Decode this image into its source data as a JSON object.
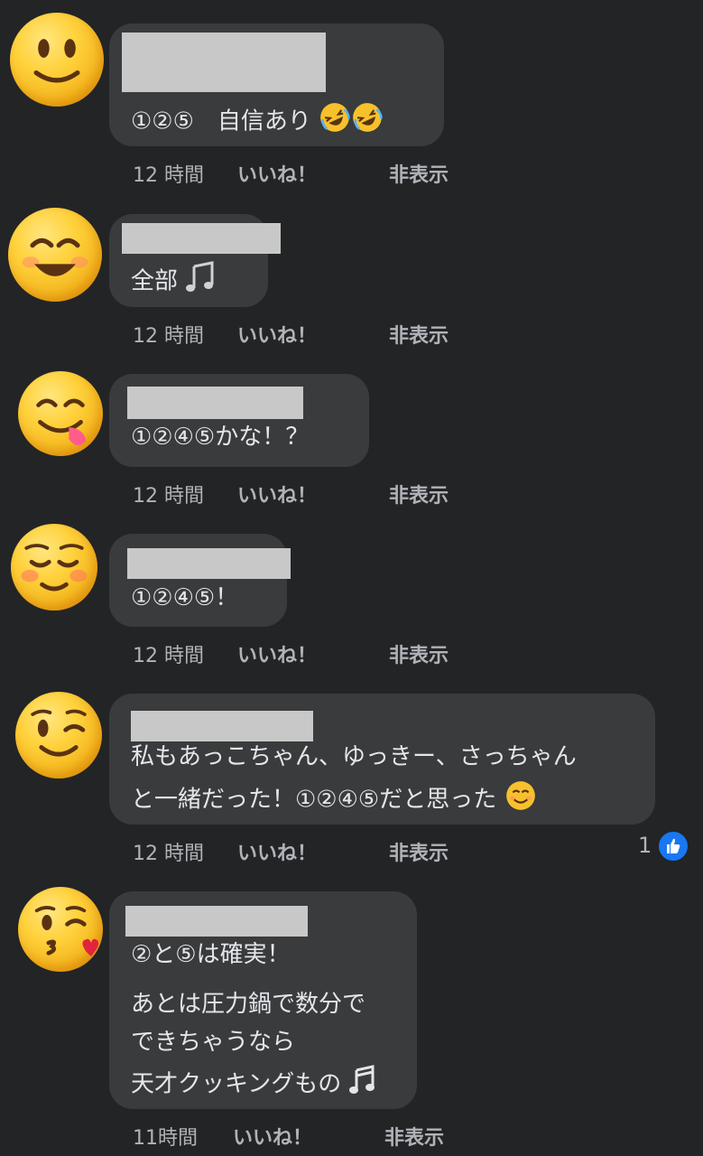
{
  "comments": [
    {
      "text": "①②⑤　自信あり",
      "time": "12 時間",
      "like": "いいね！",
      "hide": "非表示"
    },
    {
      "text": "全部",
      "time": "12 時間",
      "like": "いいね！",
      "hide": "非表示"
    },
    {
      "text": "①②④⑤かな！？",
      "time": "12 時間",
      "like": "いいね！",
      "hide": "非表示"
    },
    {
      "text": "①②④⑤！",
      "time": "12 時間",
      "like": "いいね！",
      "hide": "非表示"
    },
    {
      "text_line1": "私もあっこちゃん、ゆっきー、さっちゃん",
      "text_line2": "と一緒だった！①②④⑤だと思った",
      "time": "12 時間",
      "like": "いいね！",
      "hide": "非表示",
      "reaction_count": "1"
    },
    {
      "text_line1": "②と⑤は確実！",
      "text_line2": "あとは圧力鍋で数分で",
      "text_line3": "できちゃうなら",
      "text_line4": "天才クッキングもの",
      "time": "11時間",
      "like": "いいね！",
      "hide": "非表示"
    }
  ],
  "colors": {
    "background": "#232426",
    "bubble": "#3a3b3c",
    "text": "#e4e6eb",
    "meta": "#b0b3b8",
    "like_badge": "#1877f2"
  },
  "icons": [
    "slightly-smiling-face-icon",
    "smiling-face-icon",
    "yum-face-icon",
    "relaxed-face-icon",
    "winking-face-icon",
    "kissing-face-icon",
    "rofl-emoji-icon",
    "musical-notes-icon",
    "blush-emoji-icon",
    "thumbs-up-icon"
  ]
}
